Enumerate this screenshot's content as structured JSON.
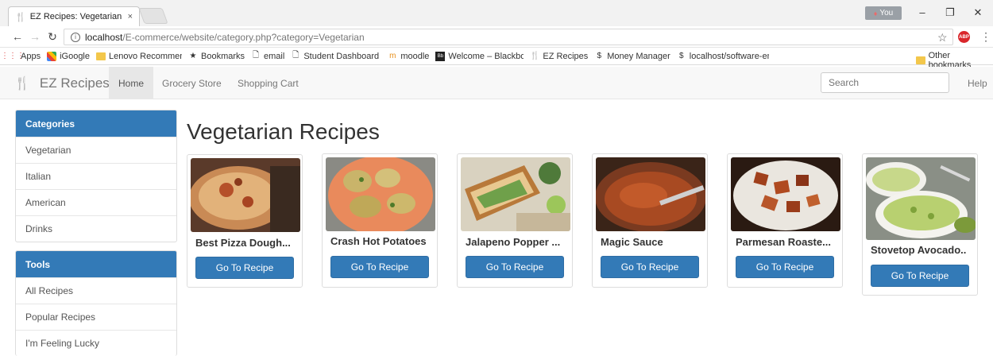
{
  "browser": {
    "tab_title": "EZ Recipes: Vegetarian",
    "tab_close": "×",
    "profile_label": "You",
    "url_host": "localhost",
    "url_path": "/E-commerce/website/category.php?category=Vegetarian",
    "bookmarks": [
      {
        "label": "Apps",
        "icon": "apps-grid-icon"
      },
      {
        "label": "iGoogle",
        "icon": "igoogle-icon"
      },
      {
        "label": "Lenovo Recommende",
        "icon": "folder-icon"
      },
      {
        "label": "Bookmarks",
        "icon": "star-icon"
      },
      {
        "label": "email",
        "icon": "page-icon"
      },
      {
        "label": "Student Dashboard H",
        "icon": "page-icon"
      },
      {
        "label": "moodle",
        "icon": "moodle-icon"
      },
      {
        "label": "Welcome – Blackboar",
        "icon": "blackboard-icon"
      },
      {
        "label": "EZ Recipes",
        "icon": "fork-knife-icon"
      },
      {
        "label": "Money Manager",
        "icon": "dollar-icon"
      },
      {
        "label": "localhost/software-en",
        "icon": "dollar-icon"
      }
    ],
    "other_bookmarks": "Other bookmarks"
  },
  "site": {
    "brand": "EZ Recipes",
    "nav": [
      "Home",
      "Grocery Store",
      "Shopping Cart"
    ],
    "search_placeholder": "Search",
    "help": "Help"
  },
  "sidebar": {
    "categories": {
      "heading": "Categories",
      "items": [
        "Vegetarian",
        "Italian",
        "American",
        "Drinks"
      ]
    },
    "tools": {
      "heading": "Tools",
      "items": [
        "All Recipes",
        "Popular Recipes",
        "I'm Feeling Lucky"
      ]
    }
  },
  "main": {
    "title": "Vegetarian Recipes",
    "button_label": "Go To Recipe",
    "recipes": [
      {
        "title": "Best Pizza Dough...",
        "image": "pizza-image"
      },
      {
        "title": "Crash Hot Potatoes",
        "image": "potatoes-image"
      },
      {
        "title": "Jalapeno Popper ...",
        "image": "sandwich-image"
      },
      {
        "title": "Magic Sauce",
        "image": "sauce-image"
      },
      {
        "title": "Parmesan Roaste...",
        "image": "roasted-potatoes-image"
      },
      {
        "title": "Stovetop Avocado..",
        "image": "avocado-image"
      }
    ]
  },
  "colors": {
    "primary": "#337ab7",
    "navbar_bg": "#f8f8f8"
  }
}
